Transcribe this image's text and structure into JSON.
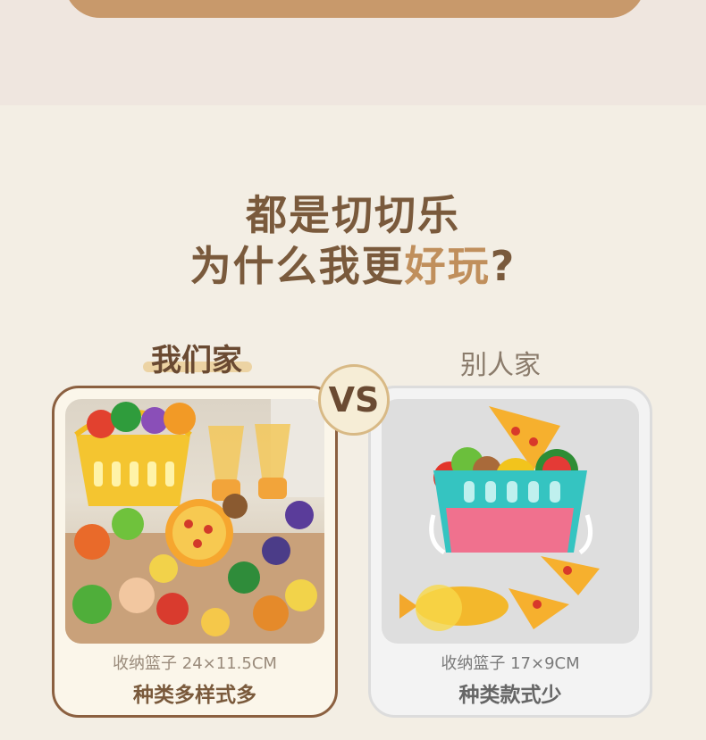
{
  "headline": {
    "line1": "都是切切乐",
    "line2_part1": "为什么我更",
    "line2_accent": "好玩",
    "line2_part2": "?"
  },
  "comparison": {
    "ours": {
      "label": "我们家",
      "spec": "收纳篮子 24×11.5CM",
      "variety": "种类多样式多"
    },
    "vs": "VS",
    "others": {
      "label": "别人家",
      "spec": "收纳篮子 17×9CM",
      "variety": "种类款式少"
    }
  },
  "colors": {
    "accent_brown": "#8b6040",
    "accent_gold": "#c08f5c",
    "background": "#f3eee4"
  }
}
